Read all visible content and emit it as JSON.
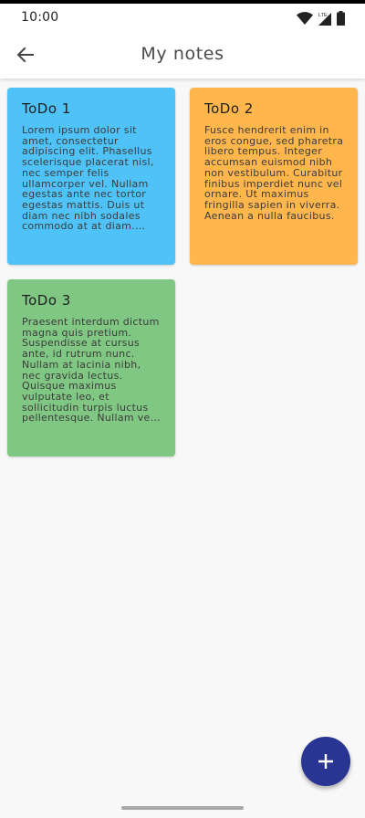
{
  "status_bar": {
    "time": "10:00",
    "network_label": "LTE",
    "icons": [
      "wifi-icon",
      "cellular-signal-icon",
      "battery-icon"
    ]
  },
  "app_bar": {
    "title": "My notes",
    "back_icon": "arrow-left-icon"
  },
  "notes": [
    {
      "title": "ToDo 1",
      "body": "Lorem ipsum dolor sit amet, consectetur adipiscing elit. Phasellus scelerisque placerat nisl, nec semper felis ullamcorper vel. Nullam egestas ante nec tortor egestas mattis. Duis ut diam nec nibh sodales commodo at at diam. Nulla facilisi.",
      "color": "#4fc3f7"
    },
    {
      "title": "ToDo 2",
      "body": "Fusce hendrerit enim in eros congue, sed pharetra libero tempus. Integer accumsan euismod nibh non vestibulum. Curabitur finibus imperdiet nunc vel ornare. Ut maximus fringilla sapien in viverra. Aenean a nulla faucibus.",
      "color": "#ffb74d"
    },
    {
      "title": "ToDo 3",
      "body": "Praesent interdum dictum magna quis pretium. Suspendisse at cursus ante, id rutrum nunc. Nullam at lacinia nibh, nec gravida lectus. Quisque maximus vulputate leo, et sollicitudin turpis luctus pellentesque. Nullam vel dui.",
      "color": "#81c784"
    }
  ],
  "fab": {
    "icon": "plus-icon",
    "color": "#283593"
  },
  "colors": {
    "app_bar": "#ffffff",
    "background": "#f8f8f8",
    "title_text": "#4a4a4a"
  }
}
